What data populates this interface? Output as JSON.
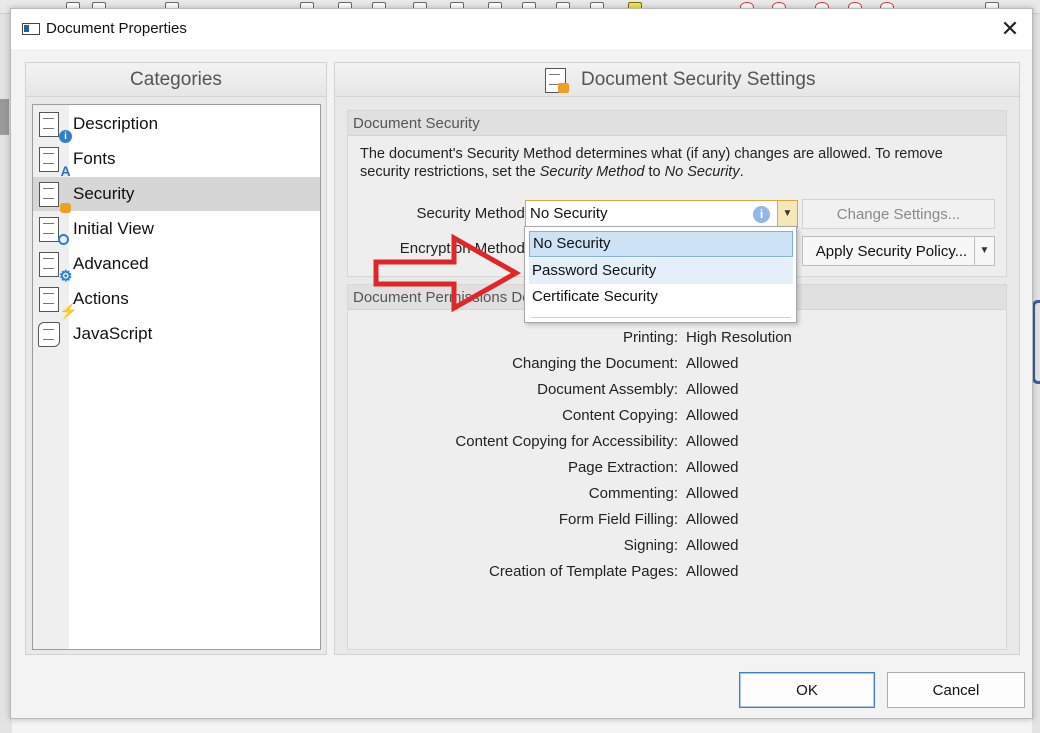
{
  "dialog": {
    "title": "Document Properties",
    "close_icon": "close-icon"
  },
  "categories": {
    "header": "Categories",
    "items": [
      {
        "label": "Description",
        "icon": "document-info-icon"
      },
      {
        "label": "Fonts",
        "icon": "document-font-icon"
      },
      {
        "label": "Security",
        "icon": "document-lock-icon",
        "selected": true
      },
      {
        "label": "Initial View",
        "icon": "document-search-icon"
      },
      {
        "label": "Advanced",
        "icon": "document-gear-icon"
      },
      {
        "label": "Actions",
        "icon": "document-action-icon"
      },
      {
        "label": "JavaScript",
        "icon": "script-scroll-icon"
      }
    ]
  },
  "security_panel": {
    "header": "Document Security Settings",
    "group_title": "Document Security",
    "desc_part1": "The document's Security Method determines what (if any) changes are allowed. To remove security restrictions, set the ",
    "desc_em1": "Security Method",
    "desc_part2": " to ",
    "desc_em2": "No Security",
    "desc_part3": ".",
    "security_method_label": "Security Method:",
    "security_method_value": "No Security",
    "encryption_method_label": "Encryption Method:",
    "change_settings_button": "Change Settings...",
    "apply_policy_button": "Apply Security Policy..."
  },
  "dropdown": {
    "options": [
      "No Security",
      "Password Security",
      "Certificate Security"
    ],
    "selected_index": 0,
    "hover_index": 1
  },
  "permissions": {
    "group_title": "Document Permissions Details",
    "rows": [
      {
        "label": "Printing:",
        "value": "High Resolution"
      },
      {
        "label": "Changing the Document:",
        "value": "Allowed"
      },
      {
        "label": "Document Assembly:",
        "value": "Allowed"
      },
      {
        "label": "Content Copying:",
        "value": "Allowed"
      },
      {
        "label": "Content Copying for Accessibility:",
        "value": "Allowed"
      },
      {
        "label": "Page Extraction:",
        "value": "Allowed"
      },
      {
        "label": "Commenting:",
        "value": "Allowed"
      },
      {
        "label": "Form Field Filling:",
        "value": "Allowed"
      },
      {
        "label": "Signing:",
        "value": "Allowed"
      },
      {
        "label": "Creation of Template Pages:",
        "value": "Allowed"
      }
    ]
  },
  "footer": {
    "ok_button": "OK",
    "cancel_button": "Cancel"
  },
  "colors": {
    "annotation_arrow": "#e0262a",
    "combo_border": "#d9a93e",
    "selection_blue": "#cde2f5"
  }
}
